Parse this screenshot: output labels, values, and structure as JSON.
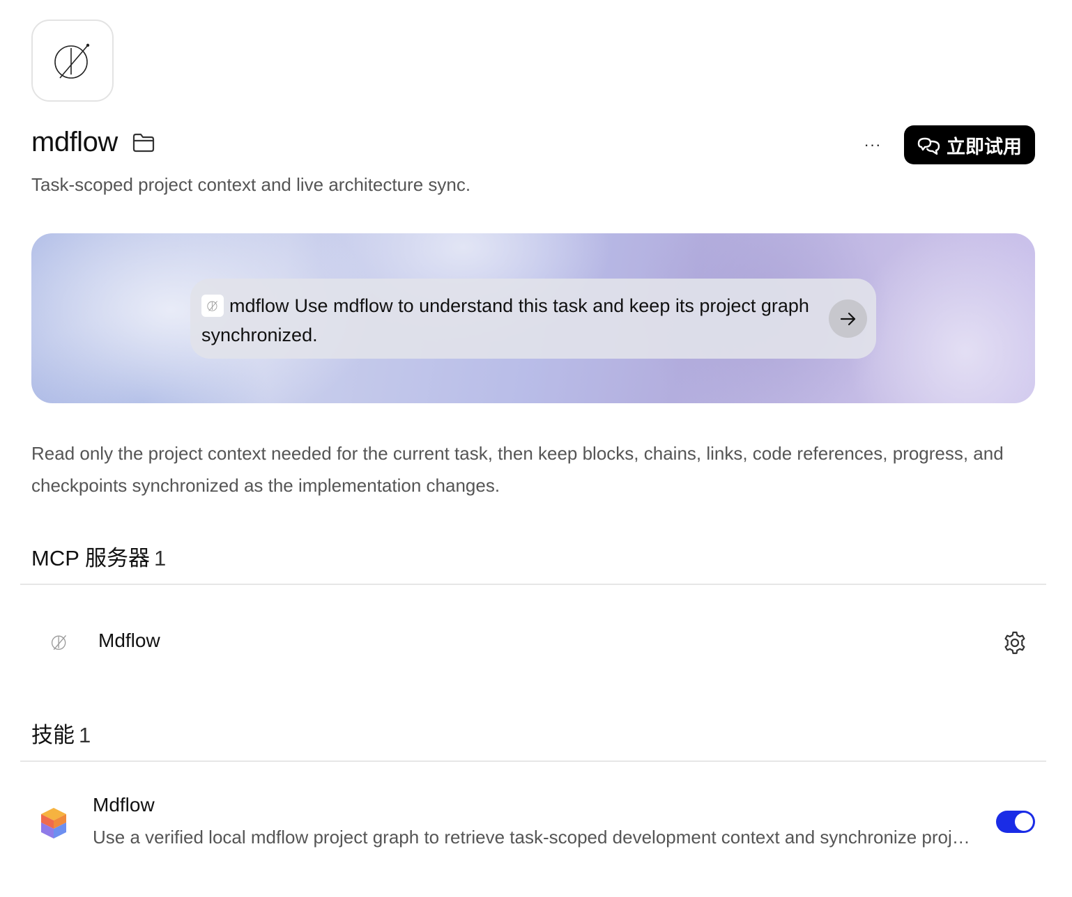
{
  "plugin": {
    "name": "mdflow",
    "tagline": "Task-scoped project context and live architecture sync.",
    "logo_icon": "slashed-circle-compass-icon"
  },
  "header_actions": {
    "more_label": "···",
    "try_label": "立即试用",
    "try_icon": "chat-bubbles-icon"
  },
  "banner": {
    "chip_label": "mdflow",
    "prompt_text": "Use mdflow to understand this task and keep its project graph synchronized.",
    "send_icon": "arrow-right-icon"
  },
  "description": "Read only the project context needed for the current task, then keep blocks, chains, links, code references, progress, and checkpoints synchronized as the implementation changes.",
  "mcp_section": {
    "title": "MCP 服务器",
    "count": "1",
    "items": [
      {
        "name": "Mdflow",
        "icon": "mdflow-logo-icon",
        "action_icon": "gear-icon"
      }
    ]
  },
  "skills_section": {
    "title": "技能",
    "count": "1",
    "items": [
      {
        "name": "Mdflow",
        "description": "Use a verified local mdflow project graph to retrieve task-scoped development context and synchronize project progress as the implementation changes.",
        "icon": "cube-stack-icon",
        "enabled": true
      }
    ]
  },
  "colors": {
    "toggle_on": "#1a2ce6",
    "button_bg": "#000000",
    "muted_text": "#555555"
  }
}
